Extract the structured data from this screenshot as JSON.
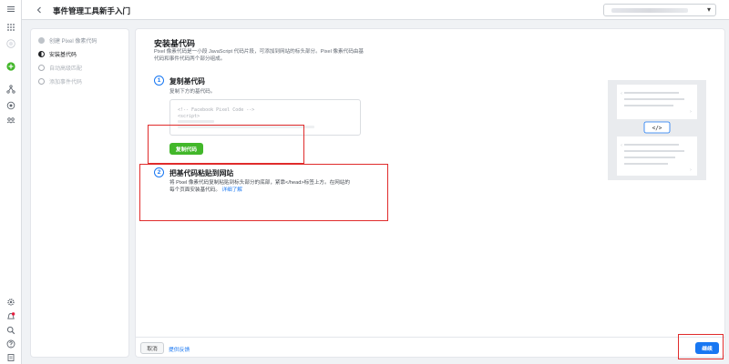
{
  "header": {
    "title": "事件管理工具新手入门",
    "account_selector_value": ""
  },
  "steps": [
    {
      "label": "创建 Pixel 像素代码",
      "state": "done"
    },
    {
      "label": "安装基代码",
      "state": "active"
    },
    {
      "label": "自动高级匹配",
      "state": "todo"
    },
    {
      "label": "添加事件代码",
      "state": "todo"
    }
  ],
  "main": {
    "title": "安装基代码",
    "intro_line1": "Pixel 像素代码是一小段 JavaScript 代码片段，可添加到网站的标头部分。Pixel 像素代码由基",
    "intro_line2": "代码和事件代码两个部分组成。",
    "step1": {
      "number": "1",
      "title": "复制基代码",
      "subtitle": "复制下方的基代码。",
      "code_lines": [
        "<!-- Facebook Pixel Code -->",
        "<script>"
      ],
      "copy_button": "复制代码"
    },
    "step2": {
      "number": "2",
      "title": "把基代码粘贴到网站",
      "desc_line1": "将 Pixel 像素代码复制粘贴到标头部分的底部，紧靠</head>标签上方。在网站的",
      "desc_line2": "每个页面安装基代码。",
      "learn_more": "详细了解"
    },
    "illustration_code": "</>"
  },
  "footer": {
    "cancel": "取消",
    "feedback": "提供反馈",
    "next": "继续"
  },
  "colors": {
    "accent": "#1877f2",
    "copy_button": "#42b72a",
    "highlight_box": "#e02b2b"
  }
}
